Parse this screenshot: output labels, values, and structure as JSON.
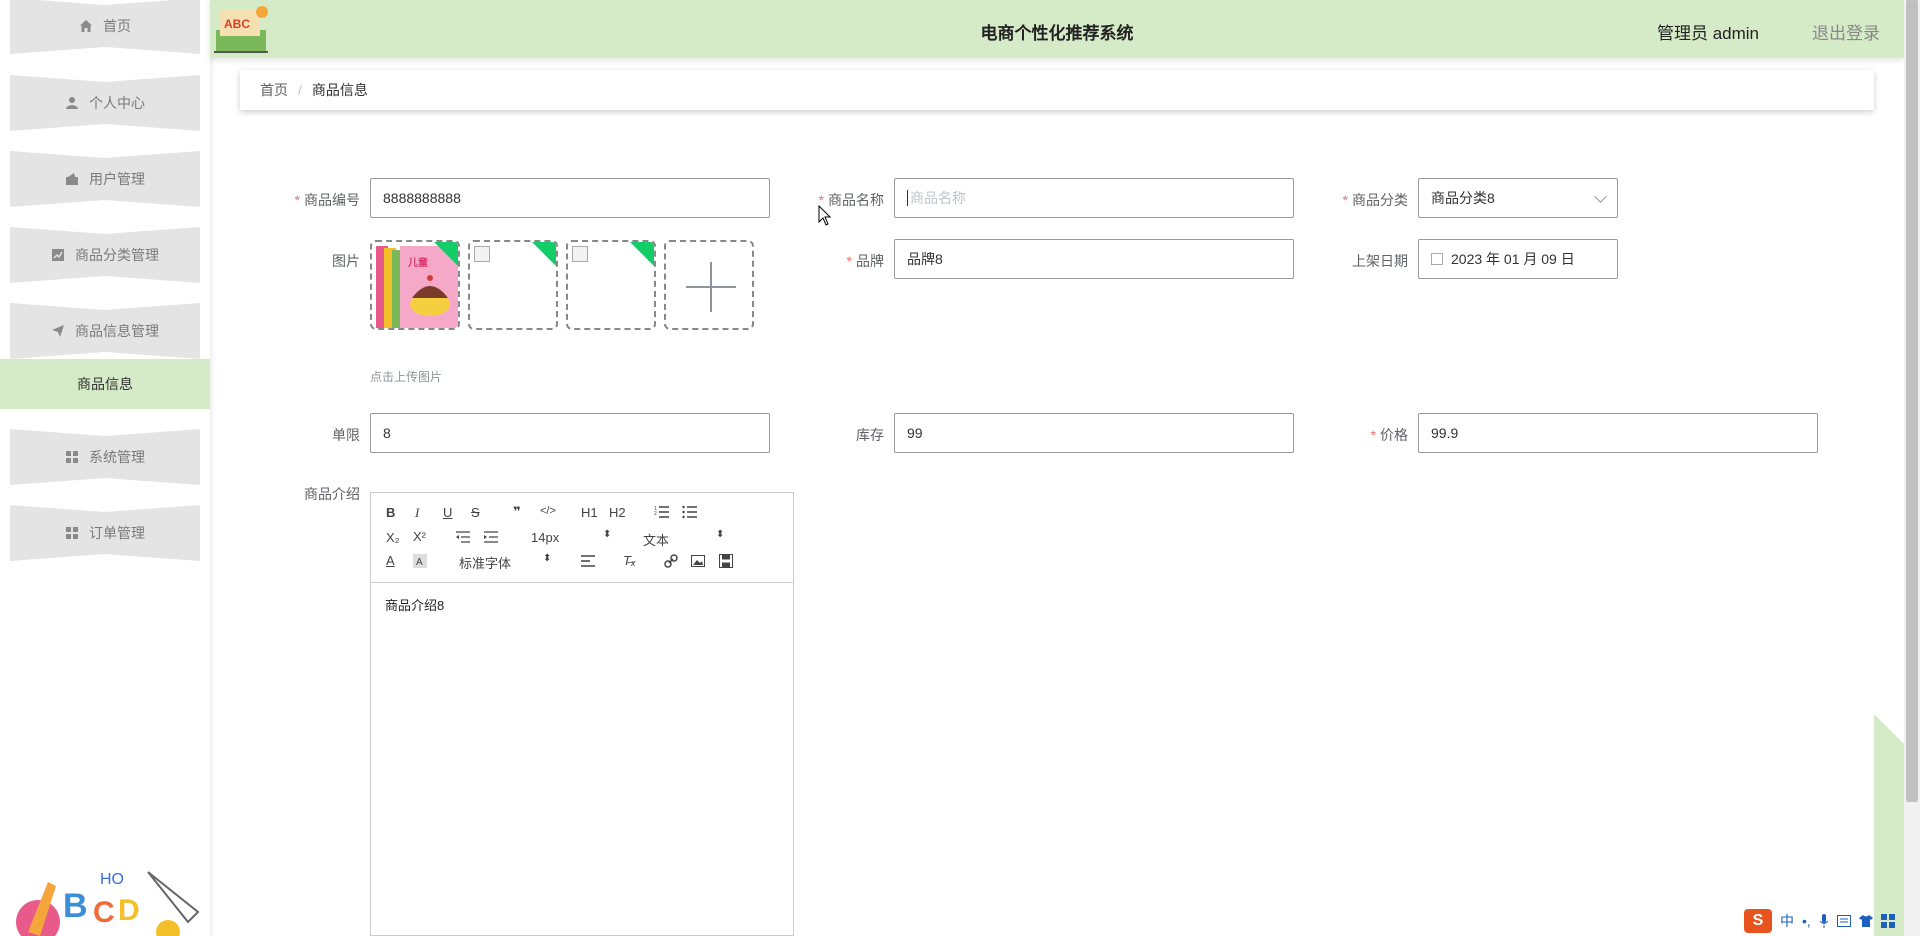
{
  "app": {
    "title": "电商个性化推荐系统",
    "user": "管理员 admin",
    "logout": "退出登录"
  },
  "sidebar": {
    "items": [
      {
        "label": "首页",
        "icon": "home-icon"
      },
      {
        "label": "个人中心",
        "icon": "user-icon"
      },
      {
        "label": "用户管理",
        "icon": "wallet-icon"
      },
      {
        "label": "商品分类管理",
        "icon": "chart-icon"
      },
      {
        "label": "商品信息管理",
        "icon": "send-icon"
      },
      {
        "label": "系统管理",
        "icon": "grid-icon"
      },
      {
        "label": "订单管理",
        "icon": "grid-icon"
      }
    ],
    "active_sub": "商品信息"
  },
  "breadcrumb": {
    "home": "首页",
    "sep": "/",
    "current": "商品信息"
  },
  "form": {
    "code": {
      "label": "商品编号",
      "value": "8888888888"
    },
    "name": {
      "label": "商品名称",
      "placeholder": "商品名称"
    },
    "category": {
      "label": "商品分类",
      "value": "商品分类8"
    },
    "image": {
      "label": "图片",
      "tip": "点击上传图片"
    },
    "brand": {
      "label": "品牌",
      "value": "品牌8"
    },
    "date": {
      "label": "上架日期",
      "value": "2023 年 01 月 09 日"
    },
    "limit": {
      "label": "单限",
      "value": "8"
    },
    "stock": {
      "label": "库存",
      "value": "99"
    },
    "price": {
      "label": "价格",
      "value": "99.9"
    },
    "intro": {
      "label": "商品介绍",
      "content": "商品介绍8"
    }
  },
  "editor": {
    "font_size": "14px",
    "block_format": "文本",
    "font_family": "标准字体",
    "buttons": [
      "B",
      "I",
      "U",
      "S",
      "❞",
      "</>",
      "H1",
      "H2",
      "ordered-list-icon",
      "bullet-list-icon",
      "X₂",
      "X²",
      "outdent-icon",
      "indent-icon",
      "A",
      "background-color-icon",
      "align-icon",
      "clear-format-icon",
      "link-icon",
      "image-icon",
      "video-icon"
    ]
  },
  "ime": {
    "lang": "中",
    "punct": "•,"
  }
}
